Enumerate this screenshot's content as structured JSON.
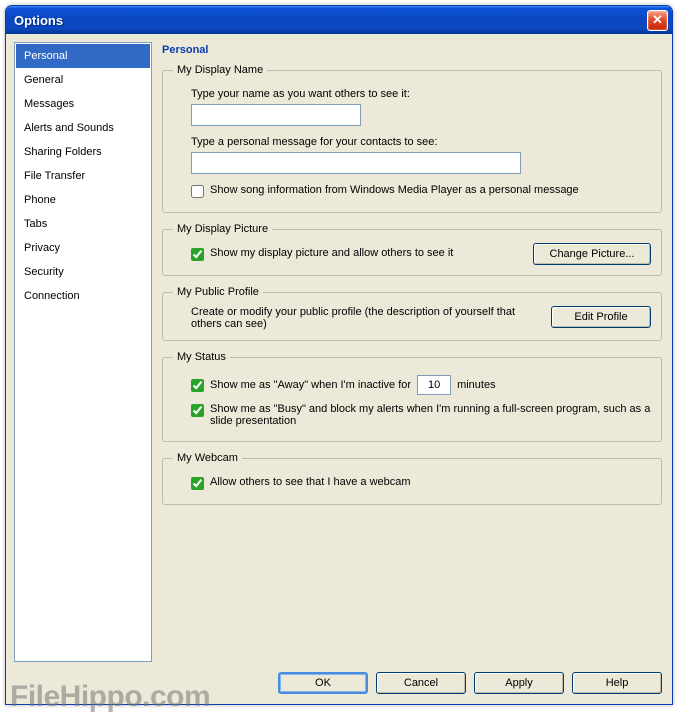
{
  "window": {
    "title": "Options",
    "close_glyph": "✕"
  },
  "sidebar": {
    "items": [
      {
        "label": "Personal",
        "selected": true
      },
      {
        "label": "General",
        "selected": false
      },
      {
        "label": "Messages",
        "selected": false
      },
      {
        "label": "Alerts and Sounds",
        "selected": false
      },
      {
        "label": "Sharing Folders",
        "selected": false
      },
      {
        "label": "File Transfer",
        "selected": false
      },
      {
        "label": "Phone",
        "selected": false
      },
      {
        "label": "Tabs",
        "selected": false
      },
      {
        "label": "Privacy",
        "selected": false
      },
      {
        "label": "Security",
        "selected": false
      },
      {
        "label": "Connection",
        "selected": false
      }
    ]
  },
  "panel": {
    "title": "Personal",
    "displayName": {
      "legend": "My Display Name",
      "name_label": "Type your name as you want others to see it:",
      "name_value": "",
      "pm_label": "Type a personal message for your contacts to see:",
      "pm_value": "",
      "song_checked": false,
      "song_label": "Show song information from Windows Media Player as a personal message"
    },
    "displayPicture": {
      "legend": "My Display Picture",
      "show_checked": true,
      "show_label": "Show my display picture and allow others to see it",
      "button": "Change Picture..."
    },
    "publicProfile": {
      "legend": "My Public Profile",
      "desc": "Create or modify your public profile (the description of yourself that others can see)",
      "button": "Edit Profile"
    },
    "status": {
      "legend": "My Status",
      "away_checked": true,
      "away_before": "Show me as \"Away\" when I'm inactive for",
      "away_value": "10",
      "away_after": "minutes",
      "busy_checked": true,
      "busy_label": "Show me as \"Busy\" and block my alerts when I'm running a full-screen program, such as a slide presentation"
    },
    "webcam": {
      "legend": "My Webcam",
      "allow_checked": true,
      "allow_label": "Allow others to see that I have a webcam"
    }
  },
  "footer": {
    "ok": "OK",
    "cancel": "Cancel",
    "apply": "Apply",
    "help": "Help"
  },
  "watermark": "FileHippo.com"
}
